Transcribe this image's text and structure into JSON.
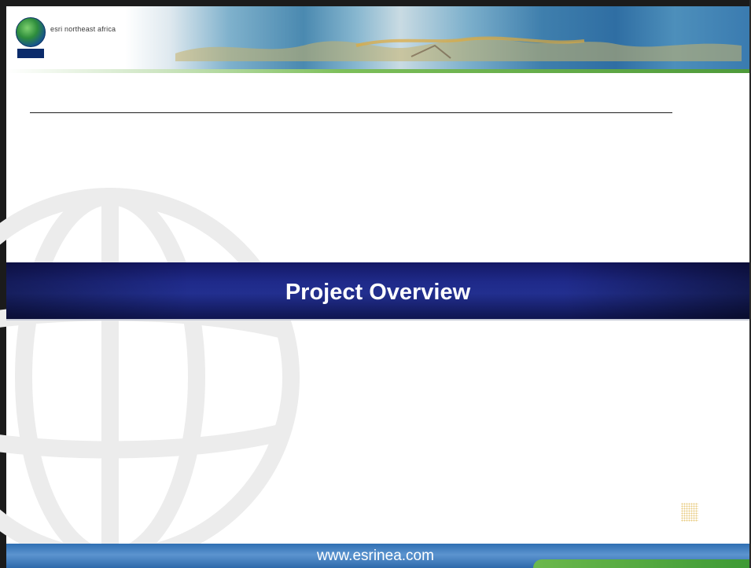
{
  "header": {
    "logo_text": "esri northeast africa"
  },
  "slide": {
    "title": "Project Overview"
  },
  "footer": {
    "url": "www.esrinea.com"
  },
  "colors": {
    "title_band": "#1f2a8a",
    "footer_band": "#3b78bd",
    "footer_accent": "#4ea43a"
  },
  "icons": {
    "logo": "globe-icon",
    "watermark": "globe-watermark-icon"
  }
}
